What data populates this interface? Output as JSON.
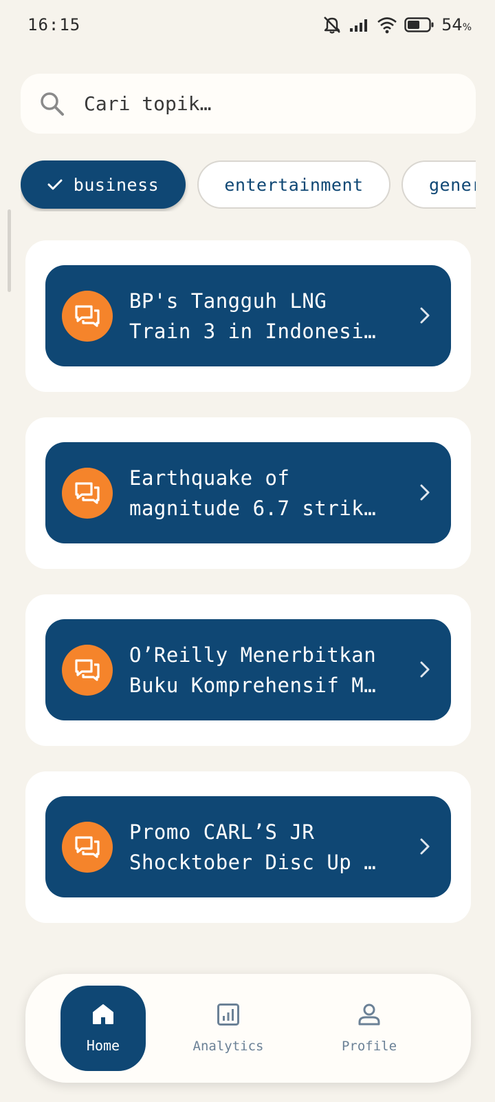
{
  "status_bar": {
    "time": "16:15",
    "battery_percent": "54",
    "battery_unit": "%",
    "icons": [
      "mute-icon",
      "signal-icon",
      "wifi-icon",
      "battery-icon"
    ]
  },
  "search": {
    "placeholder": "Cari topik…",
    "value": ""
  },
  "chips": [
    {
      "label": "business",
      "selected": true
    },
    {
      "label": "entertainment",
      "selected": false
    },
    {
      "label": "general",
      "selected": false
    }
  ],
  "articles": [
    {
      "title": "BP's Tangguh LNG Train 3 in Indonesi…",
      "icon": "chat-icon"
    },
    {
      "title": "Earthquake of magnitude 6.7 strik…",
      "icon": "chat-icon"
    },
    {
      "title": "O’Reilly Menerbitkan Buku Komprehensif M…",
      "icon": "chat-icon"
    },
    {
      "title": "Promo CARL’S JR Shocktober Disc Up …",
      "icon": "chat-icon"
    }
  ],
  "nav": {
    "home": "Home",
    "analytics": "Analytics",
    "profile": "Profile"
  },
  "colors": {
    "background": "#f6f3ec",
    "primary": "#0f4774",
    "accent": "#f5842b",
    "nav_inactive": "#6b8196"
  }
}
